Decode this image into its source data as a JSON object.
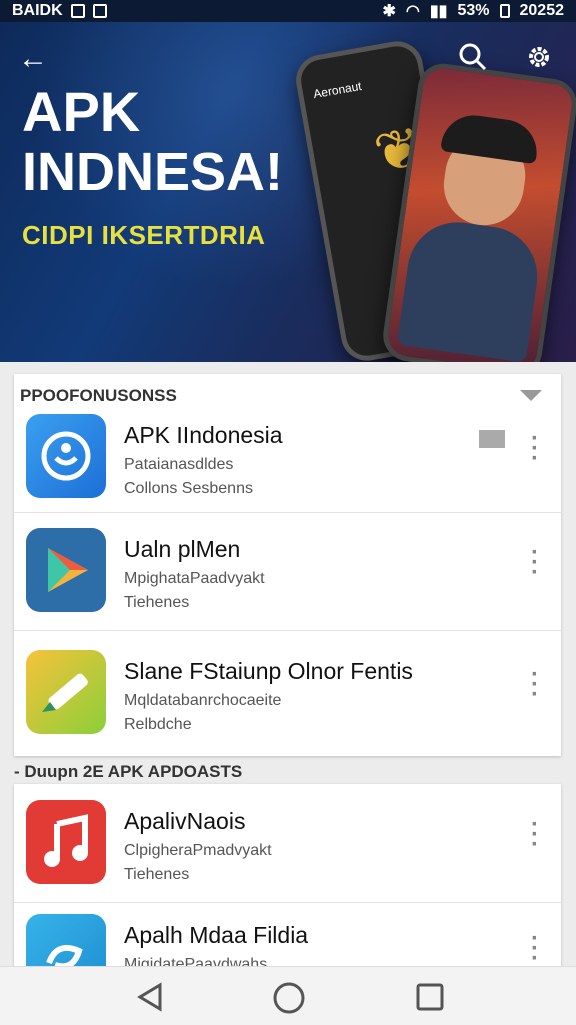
{
  "status_bar": {
    "left_text": "BAIDK",
    "right_text": "53%",
    "time": "20252"
  },
  "hero": {
    "line1": "APK",
    "line2": "INDNESA!",
    "subtitle": "CIDPI IKSERTDRIA",
    "phone_caption": "Aeronaut",
    "colors": {
      "subtitle": "#e7e03f"
    }
  },
  "section1": {
    "title": "PPOOFONUSONSS",
    "items": [
      {
        "title": "APK IIndonesia",
        "line1": "Pataianasdldes",
        "line2": "Collons Sesbenns",
        "icon": "sync-icon"
      },
      {
        "title": "Ualn plMen",
        "line1": "MpighataPaadvyakt",
        "line2": "Tiehenes",
        "icon": "play-icon"
      },
      {
        "title": "Slane FStaiunp Olnor Fentis",
        "line1": "Mqldatabanrchocaeite",
        "line2": "Relbdche",
        "icon": "pencil-icon"
      }
    ]
  },
  "section2": {
    "title": "- Duupn 2E APK APDOASTS",
    "items": [
      {
        "title": "ApalivNaois",
        "line1": "ClpigheraPmadvyakt",
        "line2": "Tiehenes",
        "icon": "music-icon"
      },
      {
        "title": "Apalh Mdaa Fildia",
        "line1": "MigidatePaavdwahs",
        "line2": "",
        "icon": "swirl-icon"
      }
    ]
  }
}
